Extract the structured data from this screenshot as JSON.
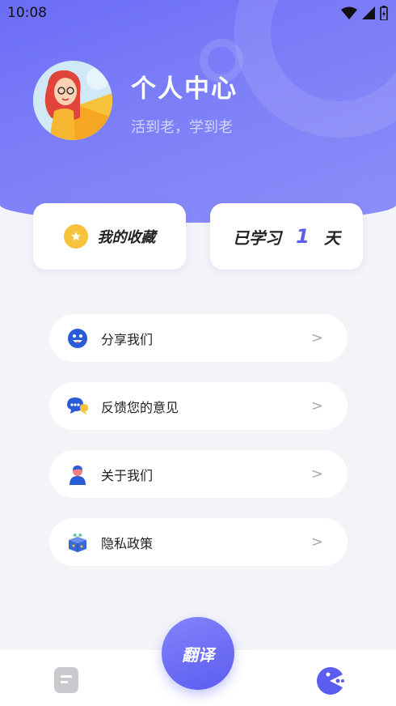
{
  "status_bar": {
    "time": "10:08",
    "icons": [
      "wifi-icon",
      "signal-icon",
      "battery-icon"
    ]
  },
  "profile": {
    "title": "个人中心",
    "subtitle": "活到老，学到老"
  },
  "cards": {
    "favorites_label": "我的收藏",
    "learned_prefix": "已学习",
    "learned_days": "1",
    "learned_suffix": "天"
  },
  "menu": [
    {
      "label": "分享我们",
      "icon": "smile-icon"
    },
    {
      "label": "反馈您的意见",
      "icon": "chat-bubble-icon"
    },
    {
      "label": "关于我们",
      "icon": "person-icon"
    },
    {
      "label": "隐私政策",
      "icon": "box-icon"
    }
  ],
  "menu_arrow": ">",
  "tabbar": {
    "center_label": "翻译",
    "left_icon": "document-icon",
    "right_icon": "profile-pacman-icon"
  },
  "colors": {
    "accent": "#6b6cf6",
    "star": "#f7c23c"
  }
}
